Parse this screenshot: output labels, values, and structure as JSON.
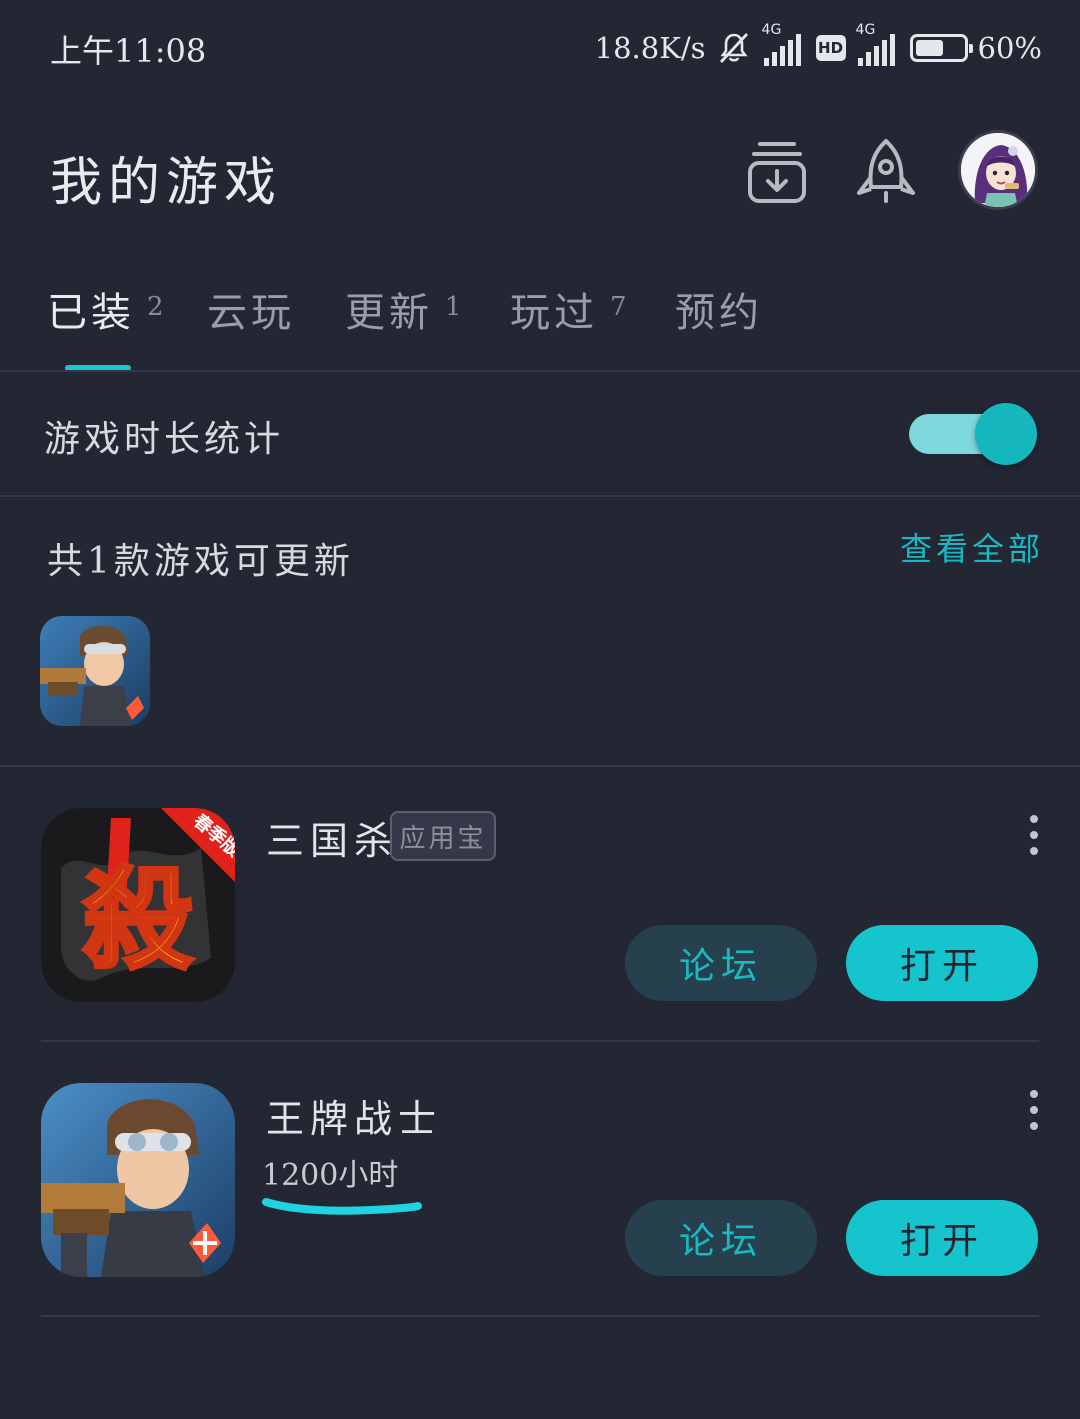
{
  "status_bar": {
    "time": "上午11:08",
    "net_speed": "18.8K/s",
    "sim1_type": "4G",
    "sim2_type": "4G",
    "hd": "HD",
    "battery_level": 0.6,
    "battery_text": "60%"
  },
  "header": {
    "title": "我的游戏"
  },
  "tabs": [
    {
      "label": "已装",
      "count": "2",
      "active": true
    },
    {
      "label": "云玩",
      "count": ""
    },
    {
      "label": "更新",
      "count": "1"
    },
    {
      "label": "玩过",
      "count": "7"
    },
    {
      "label": "预约",
      "count": ""
    }
  ],
  "playtime_toggle": {
    "label": "游戏时长统计",
    "on": true
  },
  "updates": {
    "title": "共1款游戏可更新",
    "view_all": "查看全部"
  },
  "games": [
    {
      "name": "三国杀",
      "store_badge": "应用宝",
      "icon_text": "殺",
      "icon_ribbon": "春季版",
      "forum_label": "论坛",
      "open_label": "打开"
    },
    {
      "name": "王牌战士",
      "play_time": "1200小时",
      "forum_label": "论坛",
      "open_label": "打开"
    }
  ],
  "colors": {
    "background": "#232633",
    "accent": "#16c4ce",
    "forum_button": "#26414d"
  }
}
